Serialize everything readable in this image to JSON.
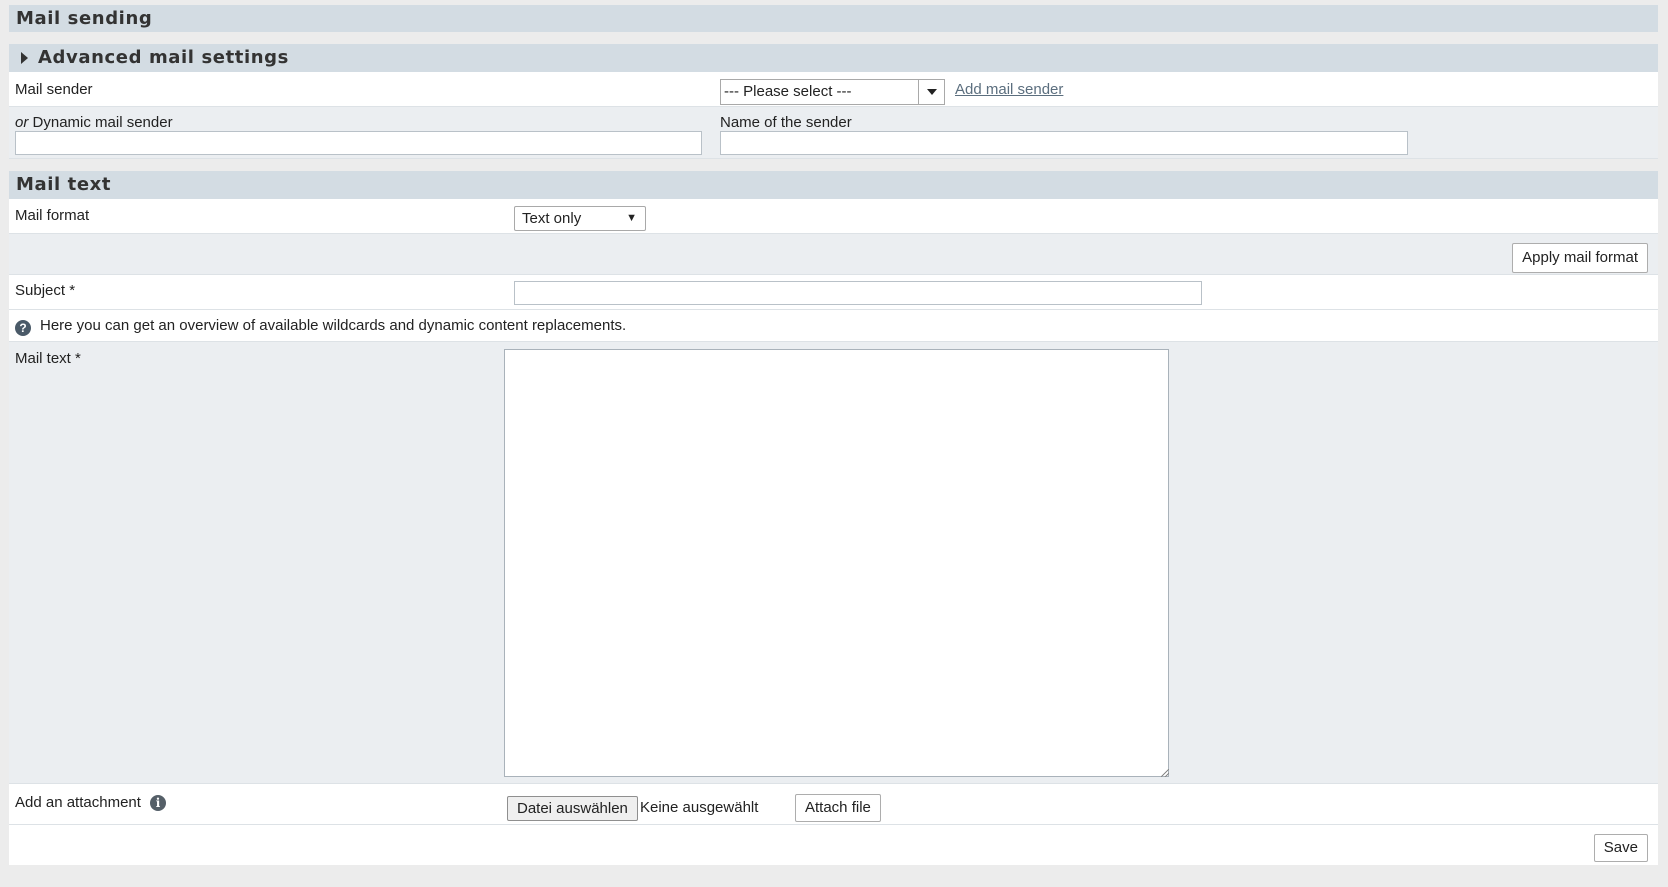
{
  "mail_sending": {
    "title": "Mail sending"
  },
  "advanced": {
    "title": "Advanced mail settings"
  },
  "sender": {
    "label": "Mail sender",
    "select_value": "--- Please select ---",
    "add_link": "Add mail sender",
    "dynamic_label_prefix": "or",
    "dynamic_label": "Dynamic mail sender",
    "dynamic_value": "",
    "name_label": "Name of the sender",
    "name_value": ""
  },
  "mail_text_section": {
    "title": "Mail text"
  },
  "format": {
    "label": "Mail format",
    "value": "Text only",
    "apply_button": "Apply mail format"
  },
  "subject": {
    "label": "Subject *",
    "value": ""
  },
  "help": {
    "text": "Here you can get an overview of available wildcards and dynamic content replacements."
  },
  "body": {
    "label": "Mail text *",
    "value": ""
  },
  "attachment": {
    "label": "Add an attachment",
    "choose_button": "Datei auswählen",
    "no_file": "Keine ausgewählt",
    "attach_button": "Attach file"
  },
  "footer": {
    "save_button": "Save"
  },
  "icons": {
    "help": "question-circle-icon",
    "info": "info-circle-icon"
  },
  "colors": {
    "header_bg": "#d3dce3",
    "row_alt_bg": "#ebeef1",
    "link": "#5b6e7e"
  }
}
